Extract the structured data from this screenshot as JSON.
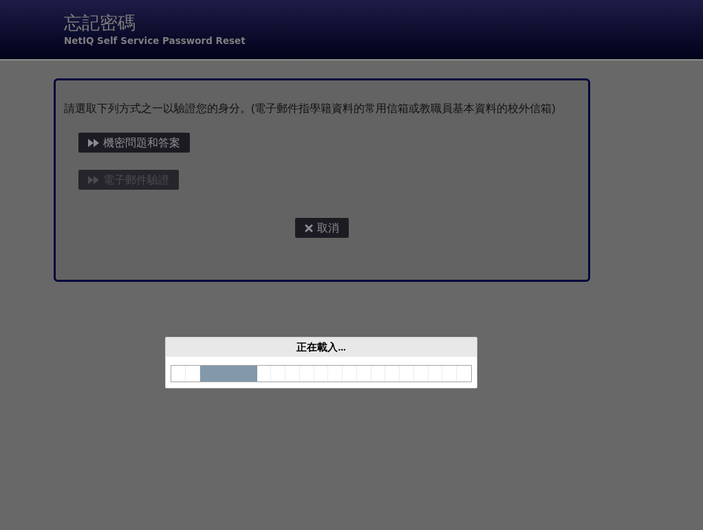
{
  "header": {
    "title": "忘記密碼",
    "subtitle": "NetIQ Self Service Password Reset"
  },
  "card": {
    "instruction": "請選取下列方式之一以驗證您的身分。(電子郵件指學籍資料的常用信箱或教職員基本資料的校外信箱)",
    "methods": [
      {
        "label": "機密問題和答案",
        "disabled": false
      },
      {
        "label": "電子郵件驗證",
        "disabled": true
      }
    ],
    "cancel_button": {
      "label": "取消"
    }
  },
  "loading_dialog": {
    "title": "正在載入..."
  }
}
